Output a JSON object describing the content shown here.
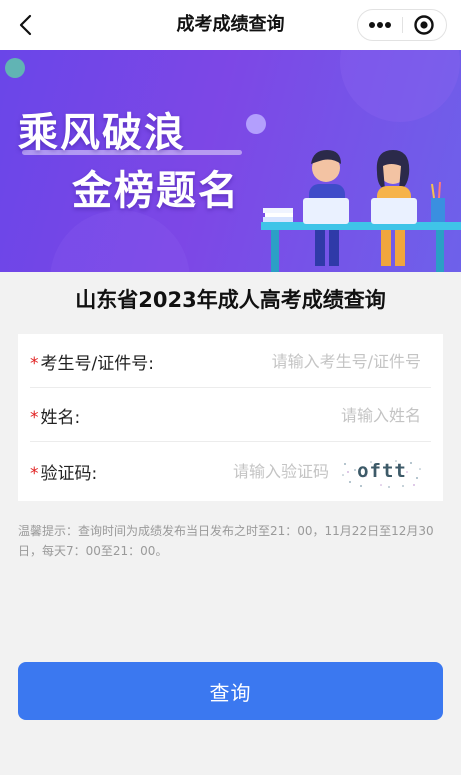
{
  "nav": {
    "title": "成考成绩查询",
    "more_icon": "more-dots-icon",
    "close_icon": "target-circle-icon",
    "back_icon": "chevron-left-icon"
  },
  "banner": {
    "slogan_line1": "乘风破浪",
    "slogan_line2": "金榜题名"
  },
  "heading": "山东省2023年成人高考成绩查询",
  "form": {
    "exam_id": {
      "label": "考生号/证件号:",
      "placeholder": "请输入考生号/证件号",
      "value": ""
    },
    "name": {
      "label": "姓名:",
      "placeholder": "请输入姓名",
      "value": ""
    },
    "captcha": {
      "label": "验证码:",
      "placeholder": "请输入验证码",
      "value": "",
      "image_text": "oftt"
    },
    "required_mark": "*"
  },
  "notice": "温馨提示：查询时间为成绩发布当日发布之时至21：00，11月22日至12月30日，每天7：00至21：00。",
  "submit_label": "查询",
  "colors": {
    "primary": "#3b78f0",
    "required": "#e02020",
    "banner_purple": "#7d47e6"
  }
}
